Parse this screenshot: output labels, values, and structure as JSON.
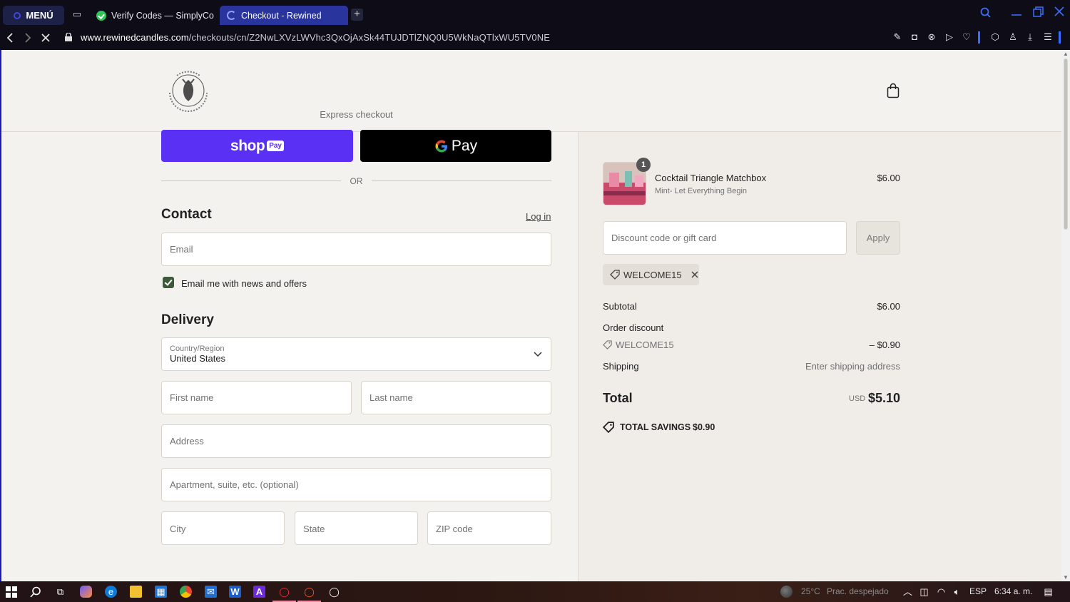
{
  "browser": {
    "menu_label": "MENÚ",
    "tabs": [
      {
        "title": "Verify Codes — SimplyCo",
        "active": false
      },
      {
        "title": "Checkout - Rewined",
        "active": true
      }
    ],
    "new_tab": "+",
    "url_host": "www.rewinedcandles.com",
    "url_path": "/checkouts/cn/Z2NwLXVzLWVhc3QxOjAxSk44TUJDTlZNQ0U5WkNaQTlxWU5TV0NE"
  },
  "checkout": {
    "express_checkout": "Express checkout",
    "shop_pay": {
      "shop": "shop",
      "pay": "Pay"
    },
    "gpay": {
      "g": "G",
      "pay": "Pay"
    },
    "or": "OR",
    "contact": {
      "heading": "Contact",
      "login": "Log in",
      "email_placeholder": "Email",
      "newsletter_label": "Email me with news and offers",
      "newsletter_checked": true
    },
    "delivery": {
      "heading": "Delivery",
      "country_label": "Country/Region",
      "country_value": "United States",
      "first_name": "First name",
      "last_name": "Last name",
      "address": "Address",
      "apartment": "Apartment, suite, etc. (optional)",
      "city": "City",
      "state": "State",
      "zip": "ZIP code"
    }
  },
  "summary": {
    "item": {
      "name": "Cocktail Triangle Matchbox",
      "variant": "Mint- Let Everything Begin",
      "price": "$6.00",
      "quantity": "1"
    },
    "discount_placeholder": "Discount code or gift card",
    "apply": "Apply",
    "applied_code": "WELCOME15",
    "subtotal_label": "Subtotal",
    "subtotal_value": "$6.00",
    "order_discount_label": "Order discount",
    "order_discount_code": "WELCOME15",
    "order_discount_value": "– $0.90",
    "shipping_label": "Shipping",
    "shipping_value": "Enter shipping address",
    "total_label": "Total",
    "total_currency": "USD",
    "total_value": "$5.10",
    "savings_label": "TOTAL SAVINGS",
    "savings_value": "$0.90"
  },
  "taskbar": {
    "weather": "25°C",
    "weather_desc": "Prac. despejado",
    "language": "ESP",
    "time": "6:34 a. m."
  },
  "colors": {
    "shop_pay": "#5a31f4",
    "checkbox": "#3f5a3b",
    "active_tab": "#29349c"
  }
}
